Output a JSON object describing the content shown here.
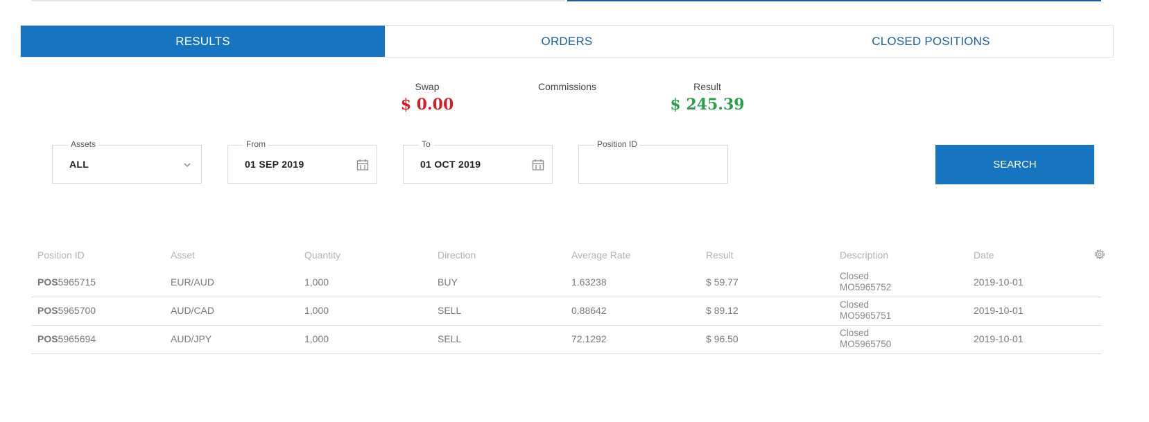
{
  "tabs": [
    {
      "label": "RESULTS",
      "active": true
    },
    {
      "label": "ORDERS",
      "active": false
    },
    {
      "label": "CLOSED POSITIONS",
      "active": false
    }
  ],
  "summary": {
    "swap_label": "Swap",
    "swap_value": "$ 0.00",
    "commissions_label": "Commissions",
    "result_label": "Result",
    "result_value": "$ 245.39"
  },
  "filters": {
    "assets_label": "Assets",
    "assets_value": "ALL",
    "from_label": "From",
    "from_value": "01 SEP 2019",
    "to_label": "To",
    "to_value": "01 OCT 2019",
    "position_id_label": "Position ID",
    "position_id_value": "",
    "search_label": "SEARCH"
  },
  "table": {
    "headers": [
      "Position ID",
      "Asset",
      "Quantity",
      "Direction",
      "Average Rate",
      "Result",
      "Description",
      "Date"
    ],
    "rows": [
      {
        "id_prefix": "POS",
        "id_num": "5965715",
        "asset": "EUR/AUD",
        "quantity": "1,000",
        "direction": "BUY",
        "rate": "1.63238",
        "result": "$ 59.77",
        "desc1": "Closed",
        "desc2": "MO5965752",
        "date": "2019-10-01"
      },
      {
        "id_prefix": "POS",
        "id_num": "5965700",
        "asset": "AUD/CAD",
        "quantity": "1,000",
        "direction": "SELL",
        "rate": "0.88642",
        "result": "$ 89.12",
        "desc1": "Closed",
        "desc2": "MO5965751",
        "date": "2019-10-01"
      },
      {
        "id_prefix": "POS",
        "id_num": "5965694",
        "asset": "AUD/JPY",
        "quantity": "1,000",
        "direction": "SELL",
        "rate": "72.1292",
        "result": "$ 96.50",
        "desc1": "Closed",
        "desc2": "MO5965750",
        "date": "2019-10-01"
      }
    ]
  },
  "colors": {
    "accent": "#1774c0",
    "negative": "#d2202a",
    "positive": "#27a148"
  },
  "icons": {
    "assets_dropdown": "chevron-down-icon",
    "from_date": "calendar-icon",
    "to_date": "calendar-icon",
    "table_settings": "gear-icon"
  }
}
